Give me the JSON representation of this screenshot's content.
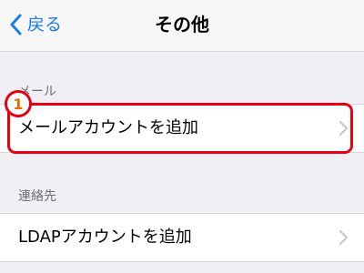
{
  "navbar": {
    "back_label": "戻る",
    "title": "その他"
  },
  "sections": [
    {
      "header": "メール",
      "rows": [
        {
          "label": "メールアカウントを追加"
        }
      ]
    },
    {
      "header": "連絡先",
      "rows": [
        {
          "label": "LDAPアカウントを追加"
        }
      ]
    }
  ],
  "annotation": {
    "step_number": "1",
    "color": "#e60012"
  },
  "colors": {
    "accent": "#1a7cf6",
    "background": "#efeff4",
    "highlight": "#e60012"
  },
  "icons": {
    "back": "chevron-left-icon",
    "row_disclosure": "chevron-right-icon"
  }
}
